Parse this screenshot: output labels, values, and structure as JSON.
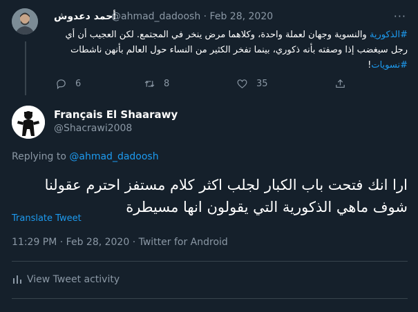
{
  "parent_tweet": {
    "display_name": "أحمد دعدوش",
    "handle_and_date": "@ahmad_dadoosh · Feb 28, 2020",
    "text_parts": [
      "#الذكورية",
      " والنسوية وجهان لعملة واحدة، وكلاهما مرض ينخر في المجتمع. لكن العجيب أن أي رجل سيغضب إذا وصفته بأنه ذكوري، بينما تفخر الكثير من النساء حول العالم بأنهن ناشطات ",
      "#نسويات",
      "!"
    ],
    "replies": "6",
    "retweets": "8",
    "likes": "35"
  },
  "main_tweet": {
    "display_name": "Français El Shaarawy",
    "handle": "@Shacrawi2008",
    "replying_prefix": "Replying to ",
    "replying_to": "@ahmad_dadoosh",
    "text": "ارا انك فتحت باب الكبار لجلب اكثر كلام مستفز احترم عقولنا شوف ماهي الذكورية التي يقولون انها مسيطرة",
    "translate_label": "Translate Tweet",
    "meta": "11:29 PM · Feb 28, 2020 · Twitter for Android",
    "activity_label": "View Tweet activity"
  },
  "icons": {
    "more": "more-dots-icon",
    "reply": "reply-bubble-icon",
    "retweet": "retweet-icon",
    "like": "heart-icon",
    "share": "share-icon",
    "activity": "bar-chart-icon"
  },
  "colors": {
    "background": "#15202b",
    "accent": "#1d9bf0",
    "secondary_text": "#8b98a5",
    "divider": "#38444d"
  }
}
